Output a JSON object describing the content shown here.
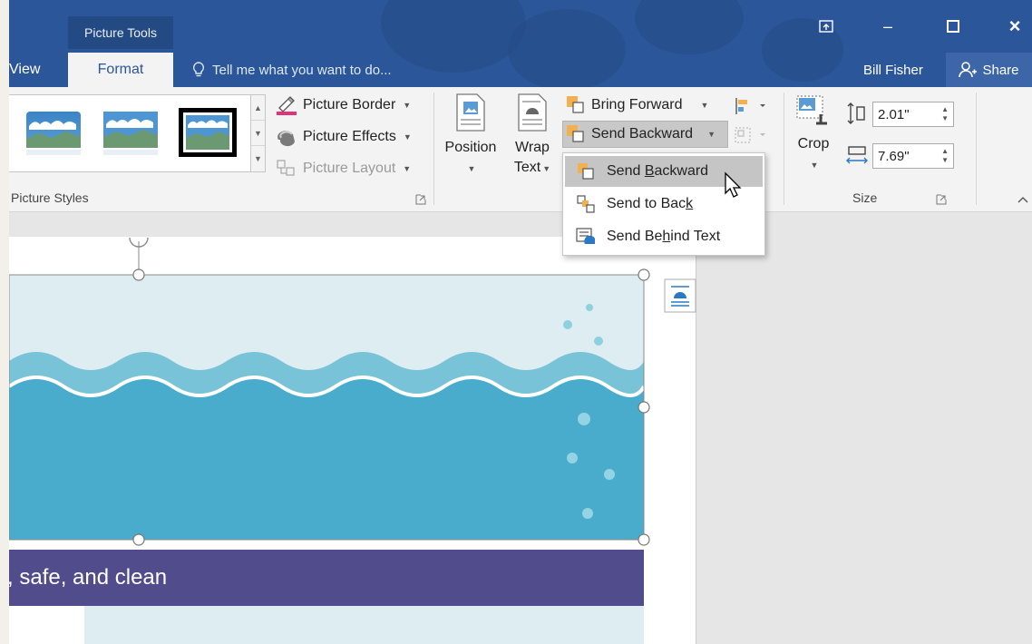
{
  "titlebar": {
    "context_tab": "Picture Tools",
    "tabs": [
      {
        "label": "View",
        "active": false
      },
      {
        "label": "Format",
        "active": true
      }
    ],
    "tell_me": "Tell me what you want to do...",
    "user": "Bill Fisher",
    "share": "Share",
    "window_buttons": {
      "restore_ribbon": "restore-ribbon-icon",
      "minimize": "–",
      "maximize": "□",
      "close": "×"
    }
  },
  "ribbon": {
    "picture_styles": {
      "label": "Picture Styles",
      "commands": {
        "border": "Picture Border",
        "effects": "Picture Effects",
        "layout": "Picture Layout"
      }
    },
    "arrange": {
      "position": "Position",
      "wrap_line1": "Wrap",
      "wrap_line2": "Text",
      "bring_forward": "Bring Forward",
      "send_backward": "Send Backward"
    },
    "size": {
      "label": "Size",
      "crop": "Crop",
      "height": "2.01\"",
      "width": "7.69\""
    }
  },
  "menu": {
    "items": [
      {
        "pre": "Send ",
        "key": "B",
        "post": "ackward",
        "hover": true
      },
      {
        "pre": "Send to Bac",
        "key": "k",
        "post": ""
      },
      {
        "pre": "Send Be",
        "key": "h",
        "post": "ind Text"
      }
    ]
  },
  "document": {
    "banner_text": ", safe, and clean"
  },
  "colors": {
    "word_blue": "#2b579a",
    "ribbon_bg": "#f3f3f3",
    "water_light": "#79c3d9",
    "water_dark": "#4aaccd",
    "banner": "#514c8c"
  }
}
